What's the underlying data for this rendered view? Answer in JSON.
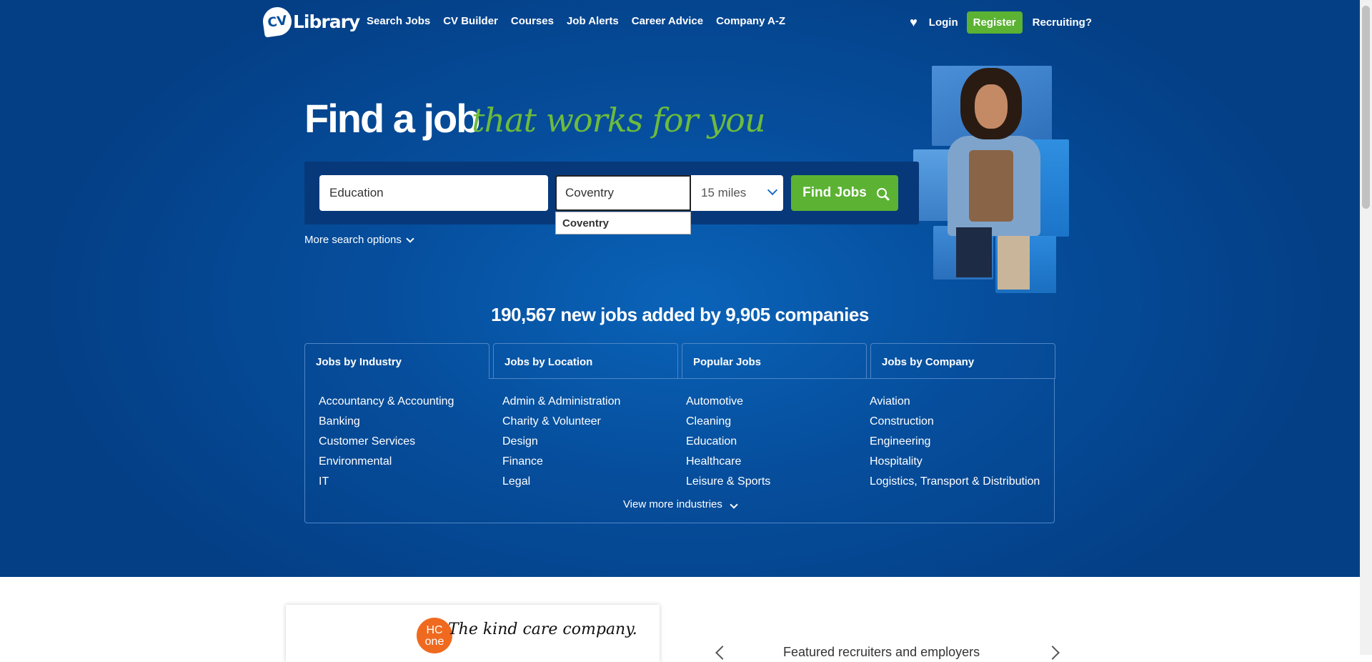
{
  "brand": {
    "logo_mark": "CV",
    "logo_word": "Library"
  },
  "nav": {
    "items": [
      "Search Jobs",
      "CV Builder",
      "Courses",
      "Job Alerts",
      "Career Advice",
      "Company A-Z"
    ],
    "favorites_icon": "heart-icon",
    "login": "Login",
    "register": "Register",
    "recruiting": "Recruiting?"
  },
  "hero": {
    "headline": "Find a job",
    "tagline": "that works for you"
  },
  "search": {
    "keywords_value": "Education",
    "location_value": "Coventry",
    "distance_value": "15 miles",
    "find_button": "Find Jobs",
    "suggestion": "Coventry",
    "more_options": "More search options"
  },
  "stats": "190,567 new jobs added by 9,905 companies",
  "tabs": [
    "Jobs by Industry",
    "Jobs by Location",
    "Popular Jobs",
    "Jobs by Company"
  ],
  "industries": {
    "col1": [
      "Accountancy & Accounting",
      "Banking",
      "Customer Services",
      "Environmental",
      "IT"
    ],
    "col2": [
      "Admin & Administration",
      "Charity & Volunteer",
      "Design",
      "Finance",
      "Legal"
    ],
    "col3": [
      "Automotive",
      "Cleaning",
      "Education",
      "Healthcare",
      "Leisure & Sports"
    ],
    "col4": [
      "Aviation",
      "Construction",
      "Engineering",
      "Hospitality",
      "Logistics, Transport & Distribution"
    ]
  },
  "view_more": "View more industries",
  "featured": {
    "logo_letters": "HC one",
    "logo_text": "The kind care company.",
    "heading": "Featured recruiters and employers"
  },
  "colors": {
    "brand_blue": "#064f9e",
    "accent_green": "#5bb233",
    "tagline_green": "#6dbb3c"
  }
}
